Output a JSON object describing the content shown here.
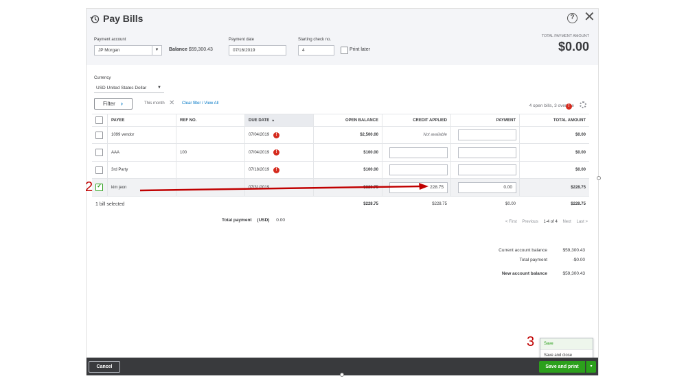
{
  "dialog": {
    "title": "Pay Bills",
    "help_symbol": "?",
    "close_symbol": "✕"
  },
  "header": {
    "payment_account_label": "Payment account",
    "payment_account_value": "JP Morgan",
    "balance_label": "Balance",
    "balance_value": "$59,300.43",
    "payment_date_label": "Payment date",
    "payment_date_value": "07/16/2019",
    "starting_check_label": "Starting check no.",
    "starting_check_value": "4",
    "print_later_label": "Print later",
    "total_payment_label": "TOTAL PAYMENT AMOUNT",
    "total_payment_value": "$0.00"
  },
  "currency": {
    "label": "Currency",
    "value": "USD United States Dollar"
  },
  "filter": {
    "button_label": "Filter",
    "chevron": "›",
    "active_filter": "This month",
    "clear_symbol": "✕",
    "clear_link": "Clear filter / View All",
    "open_bills_text": "4 open bills, 3 overdue",
    "alert_symbol": "!"
  },
  "table": {
    "columns": [
      "PAYEE",
      "REF NO.",
      "DUE DATE",
      "OPEN BALANCE",
      "CREDIT APPLIED",
      "PAYMENT",
      "TOTAL AMOUNT"
    ],
    "sort_indicator": "▲",
    "rows": [
      {
        "payee": "1099 vendor",
        "ref": "",
        "due": "07/04/2019",
        "overdue": true,
        "open_balance": "$2,500.00",
        "credit": "Not available",
        "credit_is_text": true,
        "payment": "",
        "total": "$0.00",
        "checked": false
      },
      {
        "payee": "AAA",
        "ref": "100",
        "due": "07/04/2019",
        "overdue": true,
        "open_balance": "$100.00",
        "credit": "",
        "credit_is_text": false,
        "payment": "",
        "total": "$0.00",
        "checked": false
      },
      {
        "payee": "3rd Party",
        "ref": "",
        "due": "07/18/2019",
        "overdue": true,
        "open_balance": "$100.00",
        "credit": "",
        "credit_is_text": false,
        "payment": "",
        "total": "$0.00",
        "checked": false
      },
      {
        "payee": "kim jeon",
        "ref": "",
        "due": "07/31/2019",
        "overdue": false,
        "open_balance": "$228.75",
        "credit": "228.75",
        "credit_is_text": false,
        "payment": "0.00",
        "total": "$228.75",
        "checked": true
      }
    ],
    "footer": {
      "selected_text": "1 bill selected",
      "open_balance": "$228.75",
      "credit": "$228.75",
      "payment": "$0.00",
      "total": "$228.75"
    }
  },
  "total_payment": {
    "label": "Total payment",
    "currency": "(USD)",
    "value": "0.00"
  },
  "pager": {
    "first": "< First",
    "previous": "Previous",
    "range": "1-4 of 4",
    "next": "Next",
    "last": "Last >"
  },
  "summary": {
    "current_label": "Current account balance",
    "current_value": "$59,300.43",
    "total_label": "Total payment",
    "total_value": "-$0.00",
    "new_label": "New account balance",
    "new_value": "$59,300.43"
  },
  "footer_bar": {
    "cancel_label": "Cancel",
    "save_print_label": "Save and print",
    "caret": "▾"
  },
  "save_menu": {
    "items": [
      "Save",
      "Save and close"
    ]
  },
  "annotations": {
    "step2": "2",
    "step3": "3"
  },
  "colors": {
    "accent_green": "#2ca01c",
    "link_blue": "#0077c5",
    "alert_red": "#d52b1e",
    "annotation_red": "#c00000"
  }
}
